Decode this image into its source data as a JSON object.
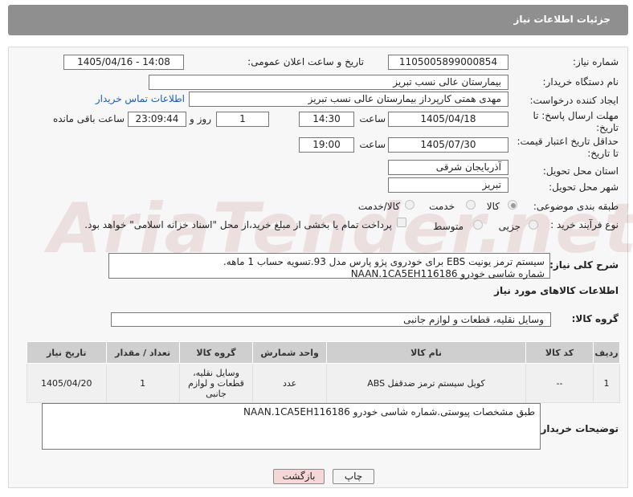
{
  "header": {
    "title": "جزئیات اطلاعات نیاز"
  },
  "watermark": {
    "text": "AriaTender.net"
  },
  "fields": {
    "need_number_label": "شماره نیاز:",
    "need_number": "1105005899000854",
    "announce_label": "تاریخ و ساعت اعلان عمومی:",
    "announce_value": "1405/04/16 - 14:08",
    "buyer_label": "نام دستگاه خریدار:",
    "buyer_value": "بیمارستان عالی نسب تبریز",
    "creator_label": "ایجاد کننده درخواست:",
    "creator_value": "مهدی همتی کارپرداز بیمارستان عالی نسب تبریز",
    "contact_link": "اطلاعات تماس خریدار",
    "deadline_label_1": "مهلت ارسال پاسخ: تا",
    "deadline_label_2": "تاریخ:",
    "deadline_date": "1405/04/18",
    "time_label": "ساعت",
    "deadline_time": "14:30",
    "days_value": "1",
    "days_label": "روز و",
    "remaining_value": "23:09:44",
    "remaining_label": "ساعت باقی مانده",
    "validity_label_1": "حداقل تاریخ اعتبار قیمت:",
    "validity_label_2": "تا تاریخ:",
    "validity_date": "1405/07/30",
    "validity_time": "19:00",
    "province_label": "استان محل تحویل:",
    "province_value": "آذربایجان شرقی",
    "city_label": "شهر محل تحویل:",
    "city_value": "تبریز",
    "category_label": "طبقه بندی موضوعی:",
    "category_options": [
      "کالا",
      "خدمت",
      "کالا/خدمت"
    ],
    "process_label": "نوع فرآیند خرید :",
    "process_options": [
      "جزیی",
      "متوسط"
    ],
    "payment_note": "پرداخت تمام یا بخشی از مبلغ خرید،از محل \"اسناد خزانه اسلامی\" خواهد بود.",
    "description_label": "شرح کلی نیاز:",
    "description_line1": "سیستم ترمز یونیت EBS برای خودروی پژو پارس مدل 93.تسویه حساب 1 ماهه.",
    "description_line2": "شماره شاسی خودرو NAAN.1CA5EH116186",
    "goods_info_title": "اطلاعات کالاهای مورد نیاز",
    "goods_group_label": "گروه کالا:",
    "goods_group_value": "وسایل نقلیه، قطعات و لوازم جانبی"
  },
  "table": {
    "headers": [
      "ردیف",
      "کد کالا",
      "نام کالا",
      "واحد شمارش",
      "گروه کالا",
      "تعداد / مقدار",
      "تاریخ نیاز"
    ],
    "rows": [
      [
        "1",
        "--",
        "کویل سیستم ترمز ضدقفل ABS",
        "عدد",
        "وسایل نقلیه، قطعات و لوازم جانبی",
        "1",
        "1405/04/20"
      ]
    ]
  },
  "buyer_notes": {
    "label": "توضیحات خریدار:",
    "text": "طبق مشخصات پیوستی.شماره شاسی خودرو NAAN.1CA5EH116186"
  },
  "buttons": {
    "print": "چاپ",
    "back": "بازگشت"
  },
  "colors": {
    "header_bg": "#8f8f8f",
    "panel_bg": "#f7f7f7",
    "table_head_bg": "#cfcfcf",
    "back_button_bg": "#f6d7d7"
  }
}
